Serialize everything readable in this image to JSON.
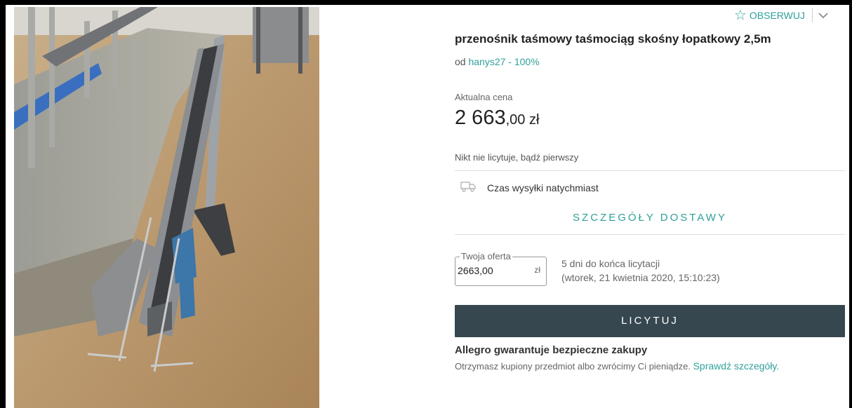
{
  "watch": {
    "label": "OBSERWUJ"
  },
  "product": {
    "title": "przenośnik taśmowy taśmociąg skośny łopatkowy 2,5m",
    "seller_prefix": "od",
    "seller": "hanys27 - 100%"
  },
  "price": {
    "label": "Aktualna cena",
    "main": "2 663",
    "decimals": ",00 zł"
  },
  "bids": {
    "status": "Nikt nie licytuje, bądź pierwszy"
  },
  "shipping": {
    "text": "Czas wysyłki natychmiast",
    "details_link": "SZCZEGÓŁY DOSTAWY"
  },
  "offer": {
    "legend": "Twoja oferta",
    "value": "2663,00",
    "unit": "zł",
    "deadline_line1": "5 dni do końca licytacji",
    "deadline_line2": "(wtorek, 21 kwietnia 2020, 15:10:23)"
  },
  "bid_button": {
    "label": "LICYTUJ"
  },
  "guarantee": {
    "title": "Allegro gwarantuje bezpieczne zakupy",
    "text": "Otrzymasz kupiony przedmiot albo zwrócimy Ci pieniądze.",
    "link": "Sprawdź szczegóły."
  },
  "colors": {
    "accent": "#2fa09a",
    "button": "#36474f"
  },
  "icons": {
    "watch": "star-icon",
    "dropdown": "chevron-down-icon",
    "shipping": "truck-icon"
  }
}
